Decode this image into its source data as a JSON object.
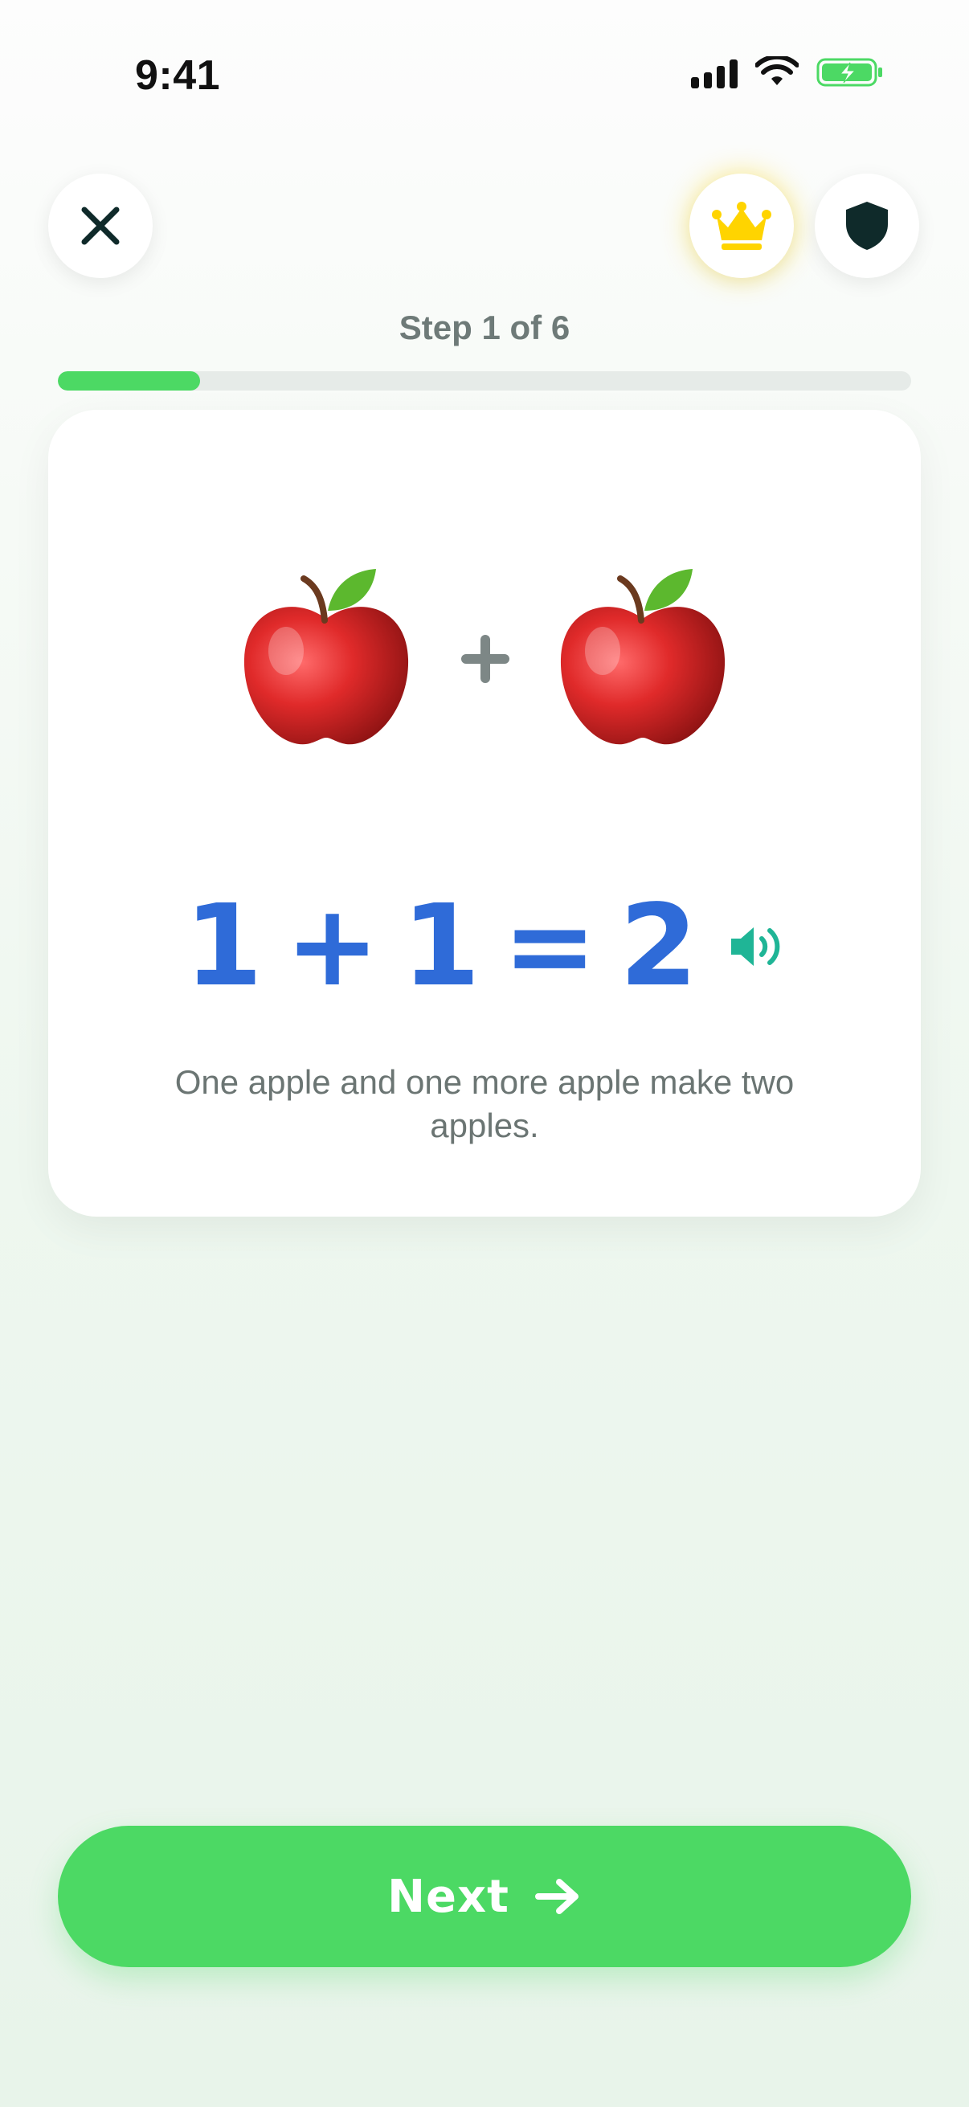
{
  "status_bar": {
    "time": "9:41"
  },
  "header": {
    "close_icon": "close-icon",
    "crown_icon": "crown-icon",
    "shield_icon": "shield-icon"
  },
  "step": {
    "label": "Step 1 of 6",
    "current": 1,
    "total": 6,
    "progress_fraction": 0.167
  },
  "card": {
    "left_item": "apple",
    "operator_icon": "plus-icon",
    "right_item": "apple",
    "equation": {
      "left": "1",
      "op": "+",
      "right": "1",
      "eq": "=",
      "result": "2"
    },
    "caption": "One apple and one more apple make two apples.",
    "audio_icon": "speaker-icon"
  },
  "footer": {
    "next_label": "Next",
    "arrow_icon": "arrow-right-icon"
  },
  "colors": {
    "accent_green": "#4cd964",
    "equation_blue": "#2f6bd8",
    "audio_teal": "#1fb596",
    "crown_gold": "#ffd400"
  }
}
